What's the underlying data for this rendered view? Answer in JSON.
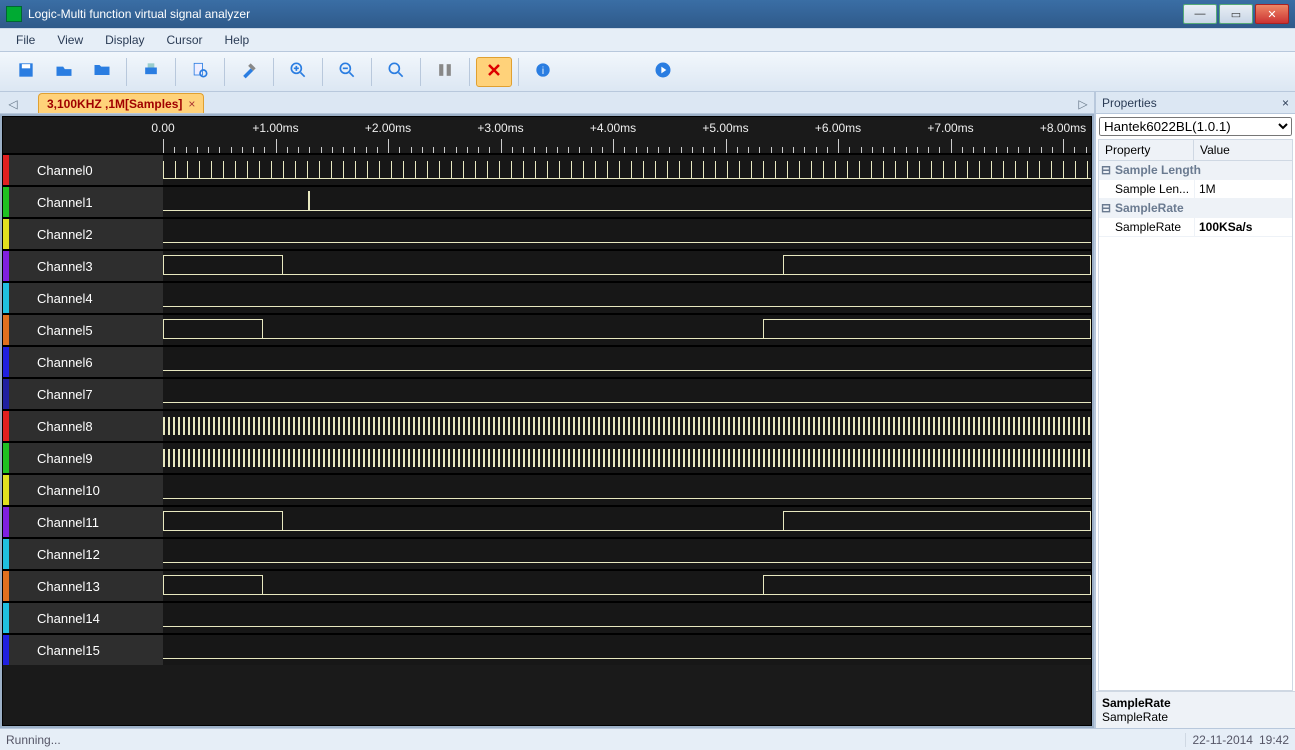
{
  "window": {
    "title": "Logic-Multi function virtual signal analyzer"
  },
  "menu": [
    "File",
    "View",
    "Display",
    "Cursor",
    "Help"
  ],
  "toolbar_icons": [
    "save",
    "open",
    "folder",
    "print",
    "print-preview",
    "tools",
    "zoom-in",
    "zoom-out",
    "zoom-fit",
    "marker",
    "clear",
    "help",
    "play"
  ],
  "tab": {
    "label": "3,100KHZ ,1M[Samples]"
  },
  "time_ticks": [
    "0.00",
    "+1.00ms",
    "+2.00ms",
    "+3.00ms",
    "+4.00ms",
    "+5.00ms",
    "+6.00ms",
    "+7.00ms",
    "+8.00ms"
  ],
  "channels": [
    {
      "name": "Channel0",
      "color": "c0",
      "pattern": "sparse-top"
    },
    {
      "name": "Channel1",
      "color": "c1",
      "pattern": "pulse-1"
    },
    {
      "name": "Channel2",
      "color": "c2",
      "pattern": "low"
    },
    {
      "name": "Channel3",
      "color": "c3",
      "pattern": "long-high-a"
    },
    {
      "name": "Channel4",
      "color": "c4",
      "pattern": "low"
    },
    {
      "name": "Channel5",
      "color": "c5",
      "pattern": "long-high-b"
    },
    {
      "name": "Channel6",
      "color": "c6",
      "pattern": "low"
    },
    {
      "name": "Channel7",
      "color": "c7",
      "pattern": "low"
    },
    {
      "name": "Channel8",
      "color": "c8",
      "pattern": "dense"
    },
    {
      "name": "Channel9",
      "color": "c9",
      "pattern": "dense"
    },
    {
      "name": "Channel10",
      "color": "c10",
      "pattern": "low"
    },
    {
      "name": "Channel11",
      "color": "c11",
      "pattern": "long-high-a"
    },
    {
      "name": "Channel12",
      "color": "c12",
      "pattern": "low"
    },
    {
      "name": "Channel13",
      "color": "c13",
      "pattern": "long-high-b"
    },
    {
      "name": "Channel14",
      "color": "c14",
      "pattern": "low"
    },
    {
      "name": "Channel15",
      "color": "c15",
      "pattern": "low"
    }
  ],
  "properties": {
    "title": "Properties",
    "device": "Hantek6022BL(1.0.1)",
    "head_prop": "Property",
    "head_val": "Value",
    "group1": "Sample Length",
    "row1_k": "Sample Len...",
    "row1_v": "1M",
    "group2": "SampleRate",
    "row2_k": "SampleRate",
    "row2_v": "100KSa/s",
    "desc_t": "SampleRate",
    "desc_b": "SampleRate"
  },
  "status": {
    "left": "Running...",
    "date": "22-11-2014",
    "time": "19:42"
  }
}
